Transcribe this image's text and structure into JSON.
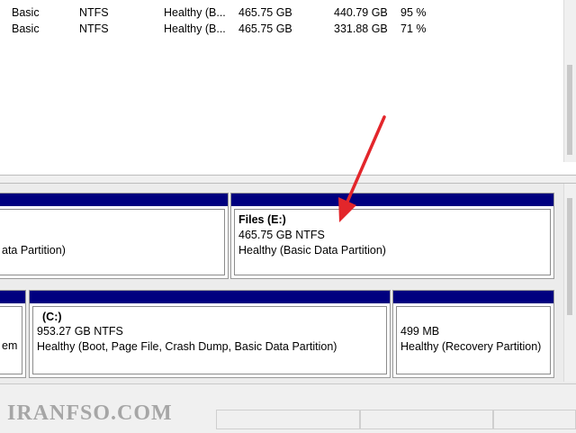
{
  "volume_list": {
    "rows": [
      {
        "type": "Basic",
        "file_system": "NTFS",
        "status": "Healthy (B...",
        "capacity": "465.75 GB",
        "free_space": "440.79 GB",
        "percent_free": "95 %"
      },
      {
        "type": "Basic",
        "file_system": "NTFS",
        "status": "Healthy (B...",
        "capacity": "465.75 GB",
        "free_space": "331.88 GB",
        "percent_free": "71 %"
      }
    ]
  },
  "disk_map": {
    "disk_a": {
      "left_partition": {
        "status": "ata Partition)"
      },
      "files_partition": {
        "name": "Files  (E:)",
        "size": "465.75 GB NTFS",
        "status": "Healthy (Basic Data Partition)"
      }
    },
    "disk_b": {
      "left_partition": {
        "status": "em"
      },
      "c_partition": {
        "name": "(C:)",
        "size": "953.27 GB NTFS",
        "status": "Healthy (Boot, Page File, Crash Dump, Basic Data Partition)"
      },
      "recovery_partition": {
        "size": "499 MB",
        "status": "Healthy (Recovery Partition)"
      }
    }
  },
  "watermark": {
    "text": "IRANFSO.COM"
  },
  "colors": {
    "partition_bar": "#00007f",
    "annotation_arrow": "#e3262b",
    "panel_background": "#ececec"
  },
  "icons": {
    "annotation": "red-arrow-icon"
  }
}
